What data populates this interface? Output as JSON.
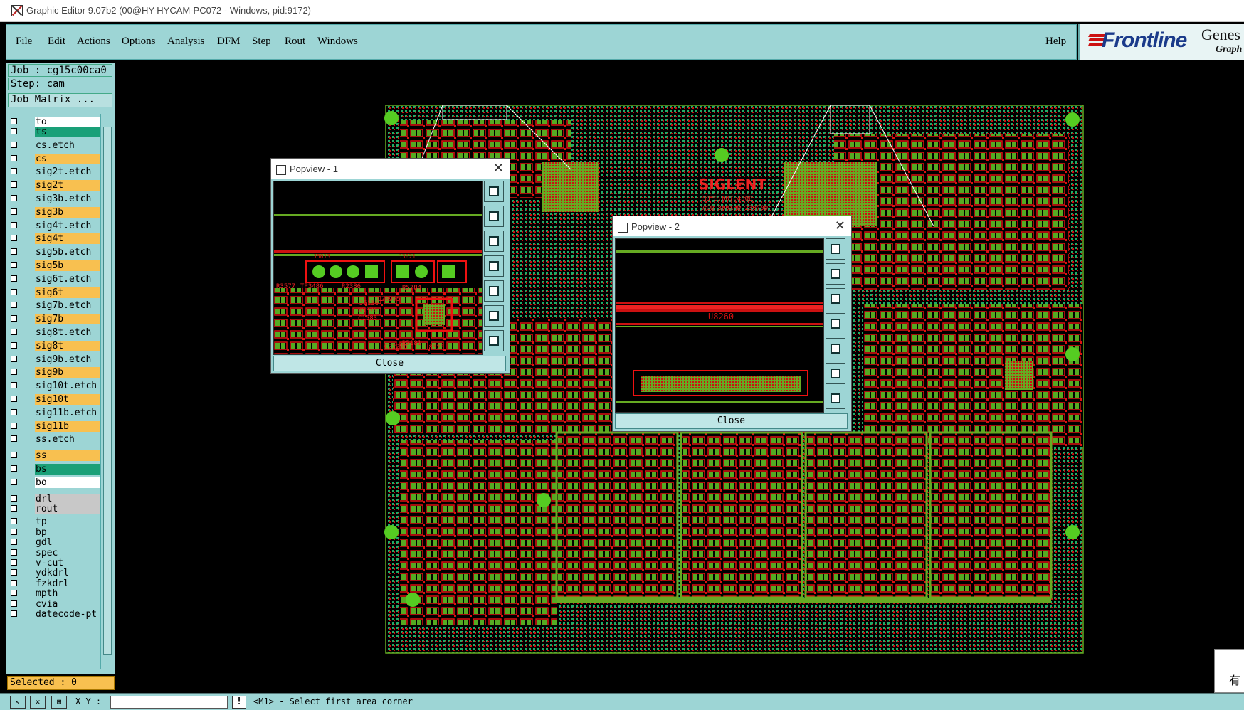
{
  "window": {
    "title": "Graphic Editor 9.07b2 (00@HY-HYCAM-PC072 - Windows, pid:9172)"
  },
  "menu": {
    "items": [
      "File",
      "Edit",
      "Actions",
      "Options",
      "Analysis",
      "DFM",
      "Step",
      "Rout",
      "Windows"
    ],
    "help": "Help"
  },
  "logo": {
    "brand": "Frontline",
    "product": "Genes",
    "sub": "Graph"
  },
  "left_panel": {
    "job": "Job : cg15c00ca0",
    "step": "Step: cam",
    "job_matrix": "Job Matrix ...",
    "layers": [
      {
        "name": "to",
        "color": "#ffffff"
      },
      {
        "name": "ts",
        "color": "#1aa078"
      },
      {
        "name": "cs.etch",
        "color": "#9dd5d5"
      },
      {
        "name": "cs",
        "color": "#f8c050"
      },
      {
        "name": "sig2t.etch",
        "color": "#9dd5d5"
      },
      {
        "name": "sig2t",
        "color": "#f8c050"
      },
      {
        "name": "sig3b.etch",
        "color": "#9dd5d5"
      },
      {
        "name": "sig3b",
        "color": "#f8c050"
      },
      {
        "name": "sig4t.etch",
        "color": "#9dd5d5"
      },
      {
        "name": "sig4t",
        "color": "#f8c050"
      },
      {
        "name": "sig5b.etch",
        "color": "#9dd5d5"
      },
      {
        "name": "sig5b",
        "color": "#f8c050"
      },
      {
        "name": "sig6t.etch",
        "color": "#9dd5d5"
      },
      {
        "name": "sig6t",
        "color": "#f8c050"
      },
      {
        "name": "sig7b.etch",
        "color": "#9dd5d5"
      },
      {
        "name": "sig7b",
        "color": "#f8c050"
      },
      {
        "name": "sig8t.etch",
        "color": "#9dd5d5"
      },
      {
        "name": "sig8t",
        "color": "#f8c050"
      },
      {
        "name": "sig9b.etch",
        "color": "#9dd5d5"
      },
      {
        "name": "sig9b",
        "color": "#f8c050"
      },
      {
        "name": "sig10t.etch",
        "color": "#9dd5d5"
      },
      {
        "name": "sig10t",
        "color": "#f8c050"
      },
      {
        "name": "sig11b.etch",
        "color": "#9dd5d5"
      },
      {
        "name": "sig11b",
        "color": "#f8c050"
      },
      {
        "name": "ss.etch",
        "color": "#9dd5d5"
      },
      {
        "name": "ss",
        "color": "#f8c050"
      },
      {
        "name": "bs",
        "color": "#1aa078"
      },
      {
        "name": "bo",
        "color": "#ffffff"
      },
      {
        "name": "drl",
        "color": "#c8c8c8"
      },
      {
        "name": "rout",
        "color": "#c8c8c8"
      },
      {
        "name": "tp",
        "color": "#9dd5d5"
      },
      {
        "name": "bp",
        "color": "#9dd5d5"
      },
      {
        "name": "gdl",
        "color": "#9dd5d5"
      },
      {
        "name": "spec",
        "color": "#9dd5d5"
      },
      {
        "name": "v-cut",
        "color": "#9dd5d5"
      },
      {
        "name": "ydkdrl",
        "color": "#9dd5d5"
      },
      {
        "name": "fzkdrl",
        "color": "#9dd5d5"
      },
      {
        "name": "mpth",
        "color": "#9dd5d5"
      },
      {
        "name": "cvia",
        "color": "#9dd5d5"
      },
      {
        "name": "datecode-pt",
        "color": "#9dd5d5"
      }
    ],
    "selected": "Selected : 0"
  },
  "pcb": {
    "brand_text": "SIGLENT",
    "model_text": "SDY8.007.430B",
    "acq_text": "ACQ 300XHD_23070D"
  },
  "popview1": {
    "title": "Popview - 1",
    "close": "Close",
    "labels": [
      "R3577",
      "TP3486",
      "C20995",
      "R5784",
      "C1583",
      "U8325",
      "R5376",
      "R5181",
      "R2386",
      "J5136",
      "C22296",
      "J5013",
      "J3021"
    ]
  },
  "popview2": {
    "title": "Popview - 2",
    "close": "Close",
    "labels": [
      "U8260"
    ]
  },
  "status": {
    "xy_label": "X Y :",
    "message": "<M1> - Select first area corner"
  },
  "corner": {
    "text": "有"
  }
}
